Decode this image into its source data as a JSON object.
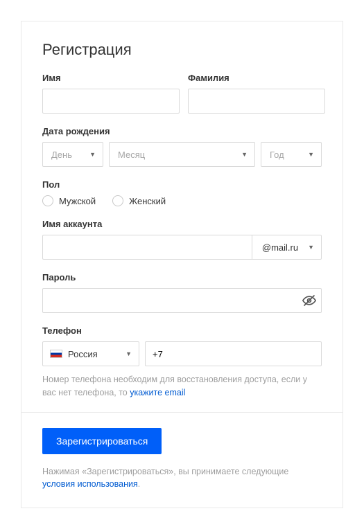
{
  "title": "Регистрация",
  "name": {
    "first_label": "Имя",
    "last_label": "Фамилия",
    "first_value": "",
    "last_value": ""
  },
  "dob": {
    "label": "Дата рождения",
    "day_placeholder": "День",
    "month_placeholder": "Месяц",
    "year_placeholder": "Год"
  },
  "gender": {
    "label": "Пол",
    "male": "Мужской",
    "female": "Женский"
  },
  "account": {
    "label": "Имя аккаунта",
    "value": "",
    "domain": "@mail.ru"
  },
  "password": {
    "label": "Пароль",
    "value": ""
  },
  "phone": {
    "label": "Телефон",
    "country": "Россия",
    "code": "+7",
    "hint_prefix": "Номер телефона необходим для восстановления доступа, если у вас нет телефона, то ",
    "hint_link": "укажите email"
  },
  "submit": "Зарегистрироваться",
  "terms": {
    "prefix": "Нажимая «Зарегистрироваться», вы принимаете следующие ",
    "link": "условия использования",
    "suffix": "."
  }
}
